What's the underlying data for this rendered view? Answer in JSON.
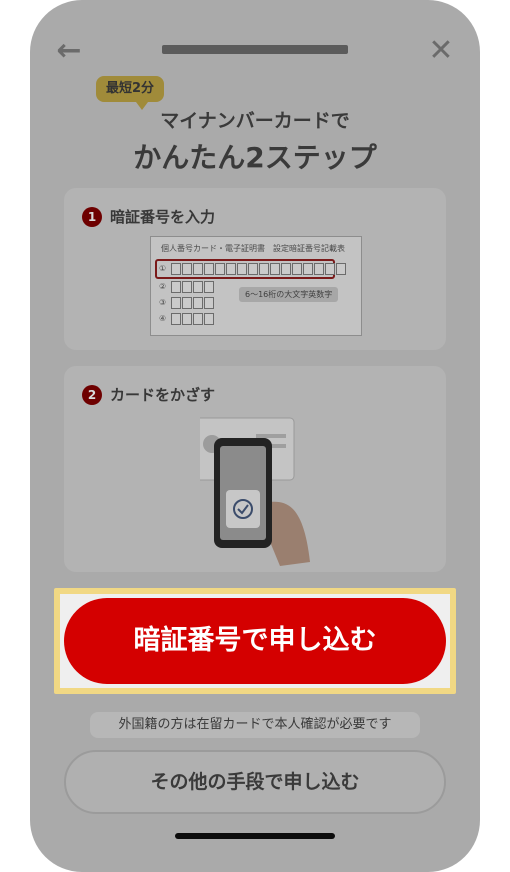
{
  "header": {
    "back_icon": "arrow-left-icon",
    "close_icon": "close-icon"
  },
  "badge": "最短2分",
  "subtitle": "マイナンバーカードで",
  "title": "かんたん2ステップ",
  "steps": [
    {
      "number": "1",
      "label": "暗証番号を入力",
      "form": {
        "header": "個人番号カード・電子証明書　設定暗証番号記載表",
        "rows": [
          "①",
          "②",
          "③",
          "④"
        ],
        "note": "6〜16桁の大文字英数字"
      }
    },
    {
      "number": "2",
      "label": "カードをかざす",
      "illustration_icon": "phone-card-check-icon"
    }
  ],
  "primary_button": "暗証番号で申し込む",
  "notice": "外国籍の方は在留カードで本人確認が必要です",
  "secondary_button": "その他の手段で申し込む",
  "colors": {
    "primary": "#d40000",
    "highlight": "#f1d884",
    "overlay": "#aaaaaa"
  }
}
